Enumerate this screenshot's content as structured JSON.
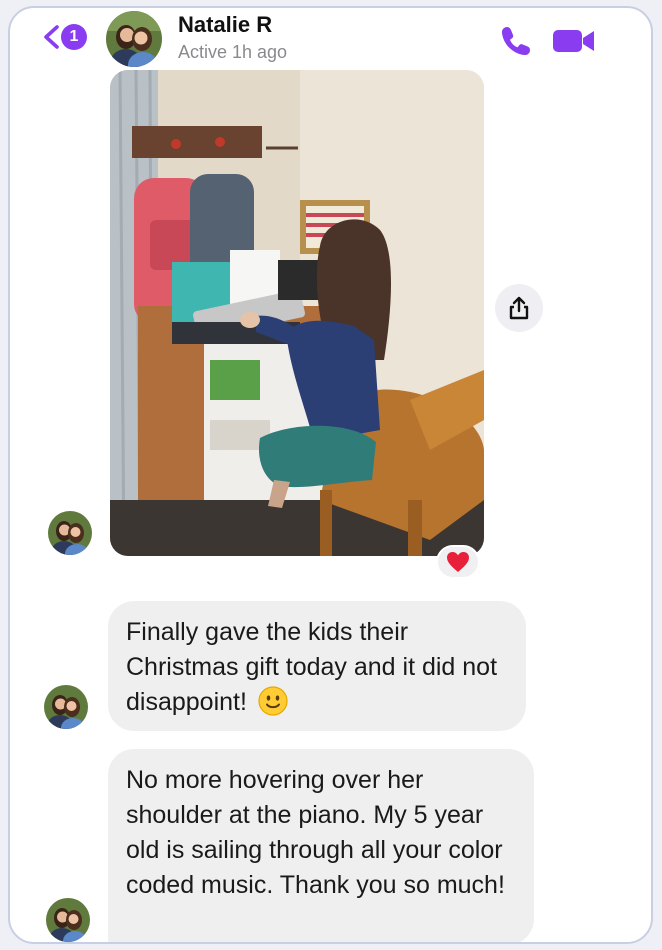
{
  "header": {
    "unread_count": "1",
    "contact_name": "Natalie R",
    "contact_status": "Active 1h ago"
  },
  "messages": [
    {
      "type": "image",
      "reaction": "red-heart"
    },
    {
      "type": "text",
      "text": "Finally gave the kids their Christmas gift today and it did not disappoint!",
      "emoji": "slightly-smiling-face"
    },
    {
      "type": "text",
      "text": "No more hovering over her shoulder at the piano. My 5 year old is sailing through all your color coded music. Thank you so much!"
    }
  ],
  "colors": {
    "accent": "#8a3cf0",
    "bubble_bg": "#efefef",
    "heart": "#e8203a"
  }
}
